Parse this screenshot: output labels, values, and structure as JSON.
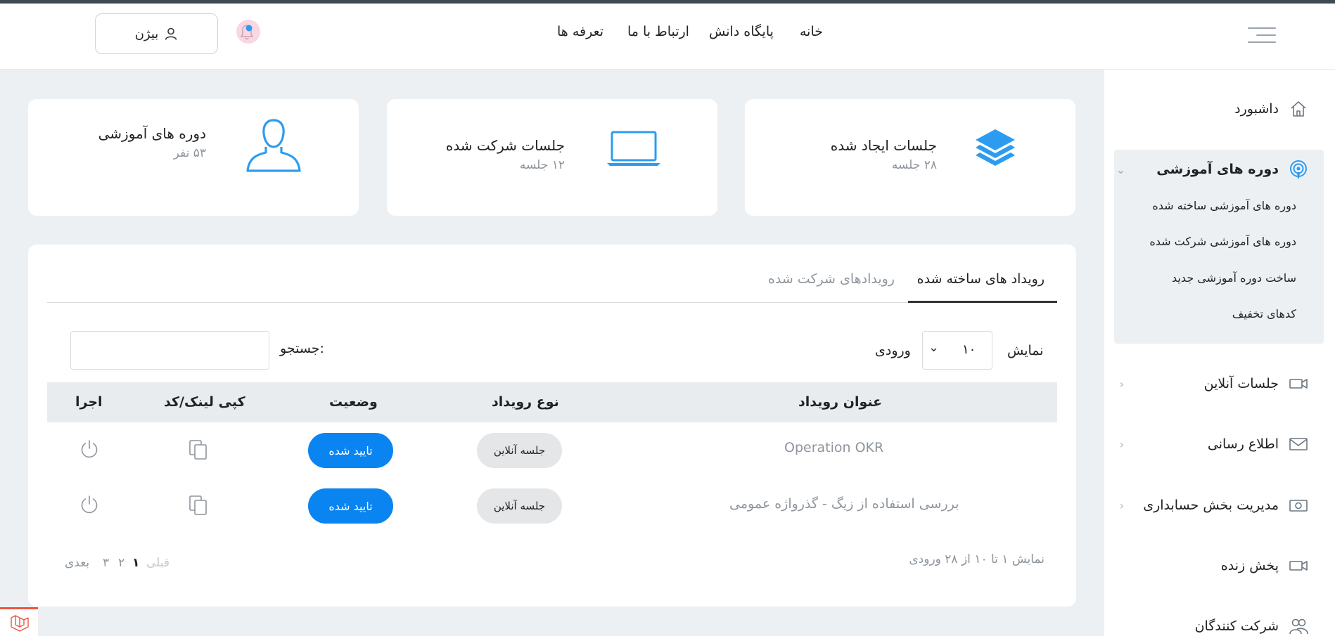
{
  "header": {
    "nav": [
      "خانه",
      "پایگاه دانش",
      "ارتباط با ما",
      "تعرفه ها"
    ],
    "login_label": "بیژن"
  },
  "sidebar": {
    "dashboard": "داشبورد",
    "courses": {
      "label": "دوره های آموزشی",
      "sub": [
        "دوره های آموزشی ساخته شده",
        "دوره های آموزشی شرکت شده",
        "ساخت دوره آموزشی جدید",
        "کدهای تخفیف"
      ]
    },
    "online_sessions": "جلسات آنلاین",
    "notifications": "اطلاع رسانی",
    "accounting": "مدیریت بخش حسابداری",
    "live": "پخش زنده",
    "participants": "شرکت کنندگان"
  },
  "cards": [
    {
      "title": "جلسات ایجاد شده",
      "sub": "۲۸ جلسه",
      "icon": "layers-icon"
    },
    {
      "title": "جلسات شرکت شده",
      "sub": "۱۲ جلسه",
      "icon": "laptop-icon"
    },
    {
      "title": "دوره های آموزشی",
      "sub": "۵۳ نفر",
      "icon": "user-icon"
    }
  ],
  "panel": {
    "tabs": [
      "رویداد های ساخته شده",
      "رویدادهای شرکت شده"
    ],
    "show_label": "نمایش",
    "entries_value": "۱۰",
    "entries_label": "ورودی",
    "search_label": "جستجو:",
    "search_value": "",
    "columns": [
      "عنوان رویداد",
      "نوع رویداد",
      "وضعیت",
      "کپی لینک/کد",
      "اجرا"
    ],
    "rows": [
      {
        "title": "Operation OKR",
        "type": "جلسه آنلاین",
        "status": "تایید شده"
      },
      {
        "title": "بررسی استفاده از زیگ - گذرواژه عمومی",
        "type": "جلسه آنلاین",
        "status": "تایید شده"
      }
    ],
    "info": "نمایش ۱ تا ۱۰ از ۲۸ ورودی",
    "pagination": {
      "prev": "قبلی",
      "pages": [
        "۱",
        "۲",
        "۳"
      ],
      "next": "بعدی"
    }
  },
  "colors": {
    "primary": "#0a84f0",
    "icon_blue": "#2d9cf0",
    "muted": "#8e959c"
  }
}
